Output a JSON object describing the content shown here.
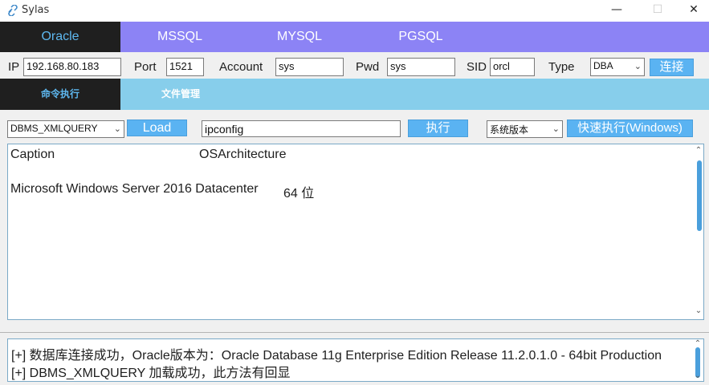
{
  "window": {
    "title": "Sylas",
    "minimize": "—",
    "maximize": "☐",
    "close": "✕"
  },
  "db_tabs": [
    "Oracle",
    "MSSQL",
    "MYSQL",
    "PGSQL"
  ],
  "connection": {
    "ip_label": "IP",
    "ip_value": "192.168.80.183",
    "port_label": "Port",
    "port_value": "1521",
    "account_label": "Account",
    "account_value": "sys",
    "pwd_label": "Pwd",
    "pwd_value": "sys",
    "sid_label": "SID",
    "sid_value": "orcl",
    "type_label": "Type",
    "type_value": "DBA",
    "connect_button": "连接"
  },
  "sub_tabs": [
    "命令执行",
    "文件管理"
  ],
  "command": {
    "method_value": "DBMS_XMLQUERY",
    "load_button": "Load",
    "command_value": "ipconfig",
    "execute_button": "执行",
    "preset_value": "系统版本",
    "quick_exec_button": "快速执行(Windows)"
  },
  "output": {
    "header_col1": "Caption",
    "header_col2": "OSArchitecture",
    "row_col1": "Microsoft Windows Server 2016 Datacenter",
    "row_col2": "64 位"
  },
  "log": [
    "[+] 数据库连接成功，Oracle版本为：Oracle Database 11g Enterprise Edition Release 11.2.0.1.0 - 64bit Production",
    "[+] DBMS_XMLQUERY 加载成功，此方法有回显"
  ],
  "colors": {
    "tab_bar": "#8c83f5",
    "active_tab_bg": "#1f1f1f",
    "active_tab_text": "#5eb8f0",
    "sub_tab_bar": "#87ceeb",
    "button_blue": "#5ab3f2"
  }
}
